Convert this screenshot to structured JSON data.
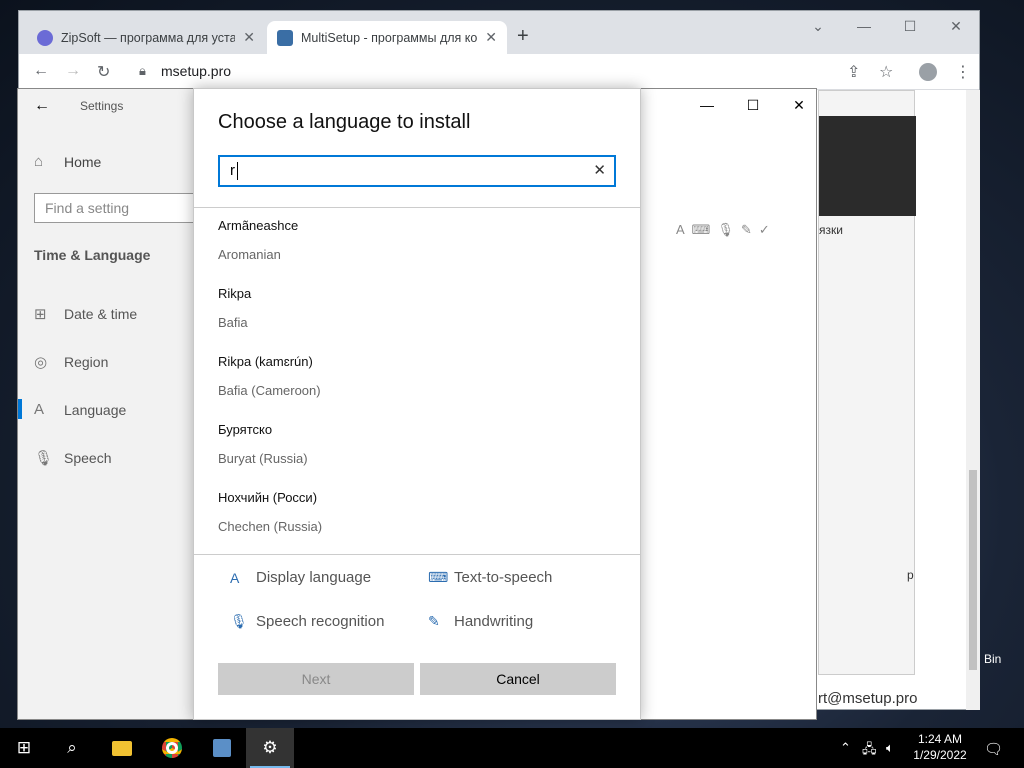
{
  "browser": {
    "tabs": [
      {
        "title": "ZipSoft — программа для устан",
        "close": "✕",
        "favicon": "zipsoft-favicon"
      },
      {
        "title": "MultiSetup - программы для ко",
        "close": "✕",
        "favicon": "multisetup-favicon"
      }
    ],
    "new_tab": "+",
    "url": "msetup.pro",
    "background_snippets": {
      "left_text": "язки",
      "right_text": "p",
      "footer_text": "rt@msetup.pro"
    }
  },
  "desktop": {
    "recycle_bin_label": "Bin"
  },
  "settings": {
    "title": "Settings",
    "home": "Home",
    "search_placeholder": "Find a setting",
    "section": "Time & Language",
    "nav": [
      {
        "label": "Date & time",
        "icon": "date-time-icon"
      },
      {
        "label": "Region",
        "icon": "region-icon"
      },
      {
        "label": "Language",
        "icon": "language-icon",
        "selected": true
      },
      {
        "label": "Speech",
        "icon": "microphone-icon"
      }
    ]
  },
  "dialog": {
    "title": "Choose a language to install",
    "search_value": "r",
    "languages": [
      {
        "native": "Armãneashce",
        "english": "Aromanian"
      },
      {
        "native": "Rikpa",
        "english": "Bafia"
      },
      {
        "native": "Rikpa (kamɛrún)",
        "english": "Bafia (Cameroon)"
      },
      {
        "native": "Бурятско",
        "english": "Buryat (Russia)"
      },
      {
        "native": "Нохчийн (Росси)",
        "english": "Chechen (Russia)"
      }
    ],
    "features": [
      {
        "label": "Display language",
        "icon": "display-language-icon"
      },
      {
        "label": "Text-to-speech",
        "icon": "text-to-speech-icon"
      },
      {
        "label": "Speech recognition",
        "icon": "speech-recognition-icon"
      },
      {
        "label": "Handwriting",
        "icon": "handwriting-icon"
      }
    ],
    "buttons": {
      "next": "Next",
      "cancel": "Cancel"
    }
  },
  "taskbar": {
    "clock_time": "1:24 AM",
    "clock_date": "1/29/2022",
    "pinned": [
      "windows-start-icon",
      "search-icon",
      "file-explorer-icon",
      "chrome-icon",
      "setup-app-icon",
      "settings-gear-icon"
    ]
  },
  "colors": {
    "accent": "#0078d7",
    "taskbar": "#000000",
    "settings_sidebar": "#f2f2f2"
  }
}
